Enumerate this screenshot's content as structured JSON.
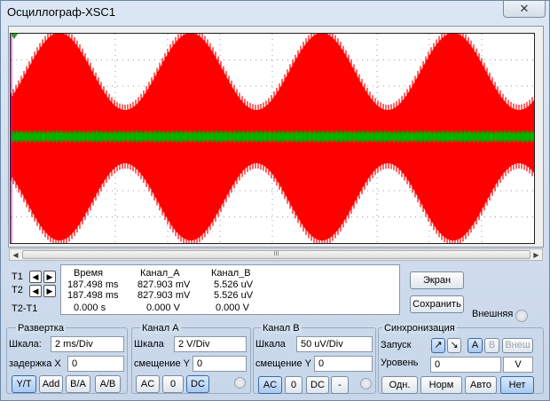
{
  "window": {
    "title": "Осциллограф-XSC1",
    "close_label": "✕"
  },
  "scrollbar": {
    "thumb_label": "III"
  },
  "cursors": {
    "t1_label": "T1",
    "t2_label": "T2",
    "diff_label": "T2-T1",
    "left_arrow": "◀",
    "right_arrow": "▶"
  },
  "readout": {
    "headers": [
      "Время",
      "Канал_А",
      "Канал_В"
    ],
    "rows": [
      [
        "187.498 ms",
        "827.903 mV",
        "5.526 uV"
      ],
      [
        "187.498 ms",
        "827.903 mV",
        "5.526 uV"
      ],
      [
        "0.000 s",
        "0.000 V",
        "0.000 V"
      ]
    ]
  },
  "right_panel": {
    "screen_button": "Экран",
    "save_button": "Сохранить",
    "external_label": "Внешняя"
  },
  "timebase": {
    "title": "Развертка",
    "scale_label": "Шкала:",
    "scale_value": "2 ms/Div",
    "delay_label": "задержка X",
    "delay_value": "0",
    "buttons": [
      "Y/T",
      "Add",
      "B/A",
      "A/B"
    ]
  },
  "channel_a": {
    "title": "Канал А",
    "scale_label": "Шкала",
    "scale_value": "2  V/Div",
    "offset_label": "смещение Y",
    "offset_value": "0",
    "buttons": [
      "AC",
      "0",
      "DC"
    ]
  },
  "channel_b": {
    "title": "Канал В",
    "scale_label": "Шкала",
    "scale_value": "50 uV/Div",
    "offset_label": "смещение Y",
    "offset_value": "0",
    "buttons": [
      "AC",
      "0",
      "DC",
      "-"
    ]
  },
  "trigger": {
    "title": "Синхронизация",
    "edge_label": "Запуск",
    "edge_rise": "↗",
    "edge_fall": "↘",
    "source_buttons": [
      "A",
      "B",
      "Внеш"
    ],
    "level_label": "Уровень",
    "level_value": "0",
    "level_unit": "V",
    "mode_buttons": [
      "Одн.",
      "Норм",
      "Авто",
      "Нет"
    ]
  },
  "colors": {
    "channel_a_trace": "#ff0000",
    "channel_b_trace": "#00b400",
    "cursor_t1": "#cc00cc"
  }
}
